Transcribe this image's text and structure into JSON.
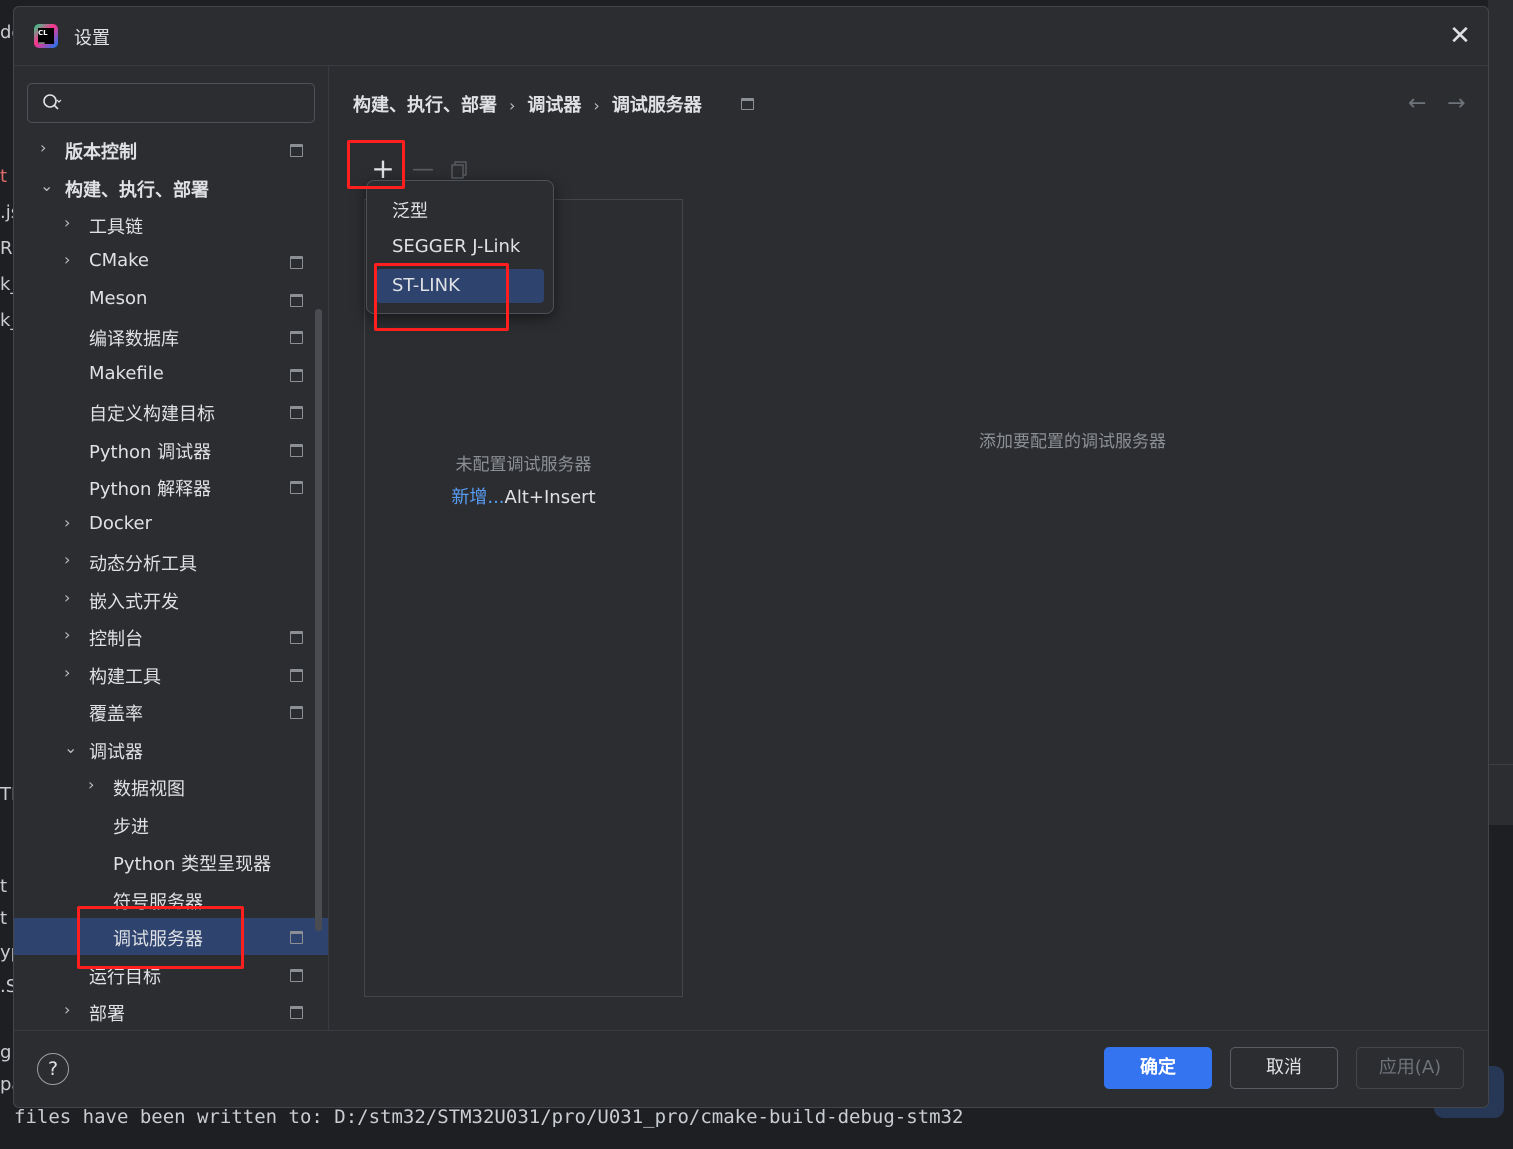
{
  "dialog": {
    "title": "设置",
    "close_icon": "close-icon"
  },
  "search": {
    "value": "",
    "icon": "search-icon"
  },
  "tree": {
    "items": [
      {
        "label": "版本控制"
      },
      {
        "label": "构建、执行、部署"
      },
      {
        "label": "工具链"
      },
      {
        "label": "CMake"
      },
      {
        "label": "Meson"
      },
      {
        "label": "编译数据库"
      },
      {
        "label": "Makefile"
      },
      {
        "label": "自定义构建目标"
      },
      {
        "label": "Python 调试器"
      },
      {
        "label": "Python 解释器"
      },
      {
        "label": "Docker"
      },
      {
        "label": "动态分析工具"
      },
      {
        "label": "嵌入式开发"
      },
      {
        "label": "控制台"
      },
      {
        "label": "构建工具"
      },
      {
        "label": "覆盖率"
      },
      {
        "label": "调试器"
      },
      {
        "label": "数据视图"
      },
      {
        "label": "步进"
      },
      {
        "label": "Python 类型呈现器"
      },
      {
        "label": "符号服务器"
      },
      {
        "label": "调试服务器"
      },
      {
        "label": "运行目标"
      },
      {
        "label": "部署"
      }
    ],
    "selected": "调试服务器"
  },
  "breadcrumb": {
    "items": [
      "构建、执行、部署",
      "调试器",
      "调试服务器"
    ],
    "separator": "›"
  },
  "toolbar": {
    "add_icon": "plus-icon",
    "remove_icon": "minus-icon",
    "copy_icon": "copy-icon"
  },
  "add_menu": {
    "items": [
      "泛型",
      "SEGGER J-Link",
      "ST-LINK"
    ],
    "highlighted": "ST-LINK"
  },
  "server_list": {
    "empty_text": "未配置调试服务器",
    "add_link": "新增...",
    "add_shortcut": "Alt+Insert"
  },
  "detail": {
    "hint": "添加要配置的调试服务器"
  },
  "footer": {
    "help_label": "?",
    "ok_label": "确定",
    "cancel_label": "取消",
    "apply_label": "应用(A)"
  },
  "background": {
    "left_fragments": [
      "de",
      "t",
      ".js",
      "Ru",
      "k_",
      "k_",
      "TI",
      "t",
      "t",
      "yp",
      ".S",
      "g",
      "pa"
    ],
    "console_text": "files have been written to: D:/stm32/STM32U031/pro/U031_pro/cmake-build-debug-stm32"
  },
  "colors": {
    "accent": "#3574f0",
    "selection": "#2e436e",
    "highlight_box": "#ff1f1f",
    "link": "#589df6"
  }
}
